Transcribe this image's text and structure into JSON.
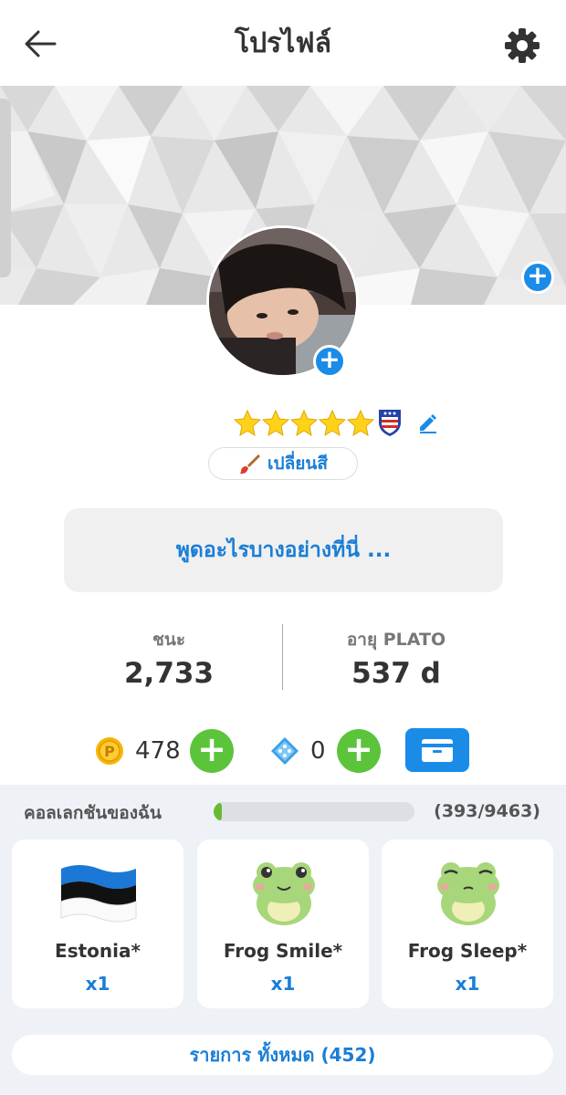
{
  "header": {
    "title": "โปรไฟล์"
  },
  "icons": {
    "back": "arrow-left-icon",
    "settings": "gear-icon",
    "edit": "pencil-icon",
    "brush": "paintbrush-icon",
    "coin": "coin-icon",
    "dice": "dice-icon",
    "wallet": "wallet-icon"
  },
  "profile": {
    "stars": 5,
    "change_color_label": "เปลี่ยนสี",
    "status_placeholder": "พูดอะไรบางอย่างที่นี่ ..."
  },
  "stats": {
    "wins_label": "ชนะ",
    "wins_value": "2,733",
    "age_label": "อายุ PLATO",
    "age_value": "537 d"
  },
  "currency": {
    "coins": "478",
    "dice": "0"
  },
  "collection": {
    "title": "คอลเลกชันของฉัน",
    "progress_text": "(393/9463)",
    "progress_fraction": 0.0415,
    "items": [
      {
        "name": "Estonia*",
        "qty": "x1"
      },
      {
        "name": "Frog Smile*",
        "qty": "x1"
      },
      {
        "name": "Frog Sleep*",
        "qty": "x1"
      }
    ],
    "all_items_label": "รายการ ทั้งหมด (452)"
  },
  "colors": {
    "accent_blue": "#1a8ce8",
    "plus_green": "#5bc43b",
    "link_blue": "#1a7ed6"
  }
}
